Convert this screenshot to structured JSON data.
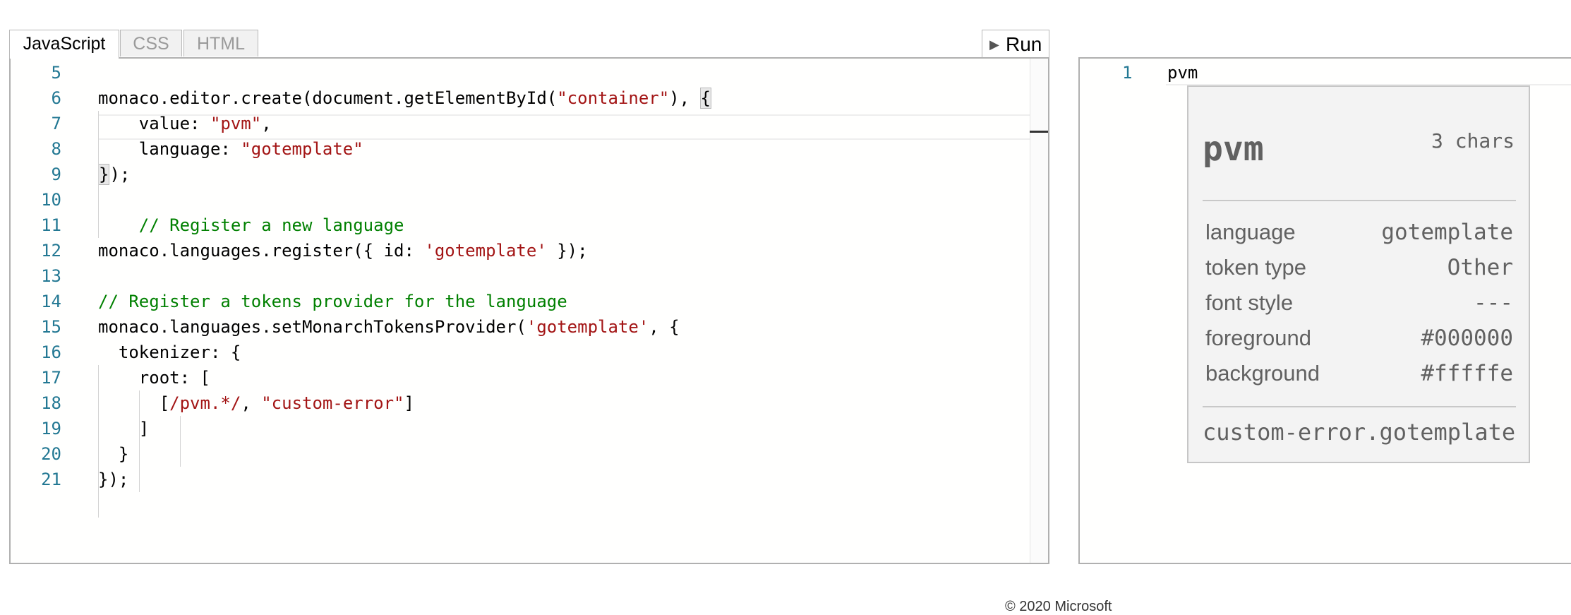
{
  "tabs": [
    "JavaScript",
    "CSS",
    "HTML"
  ],
  "run_label": "Run",
  "run_icon": "play-icon",
  "code_lines": [
    {
      "n": "5",
      "tokens": []
    },
    {
      "n": "6",
      "tokens": [
        [
          "",
          "monaco.editor.create(document.getElementById("
        ],
        [
          "str",
          "\"container\""
        ],
        [
          "",
          "), "
        ],
        [
          "brk",
          "{"
        ]
      ]
    },
    {
      "n": "7",
      "tokens": [
        [
          "",
          "    value: "
        ],
        [
          "str",
          "\"pvm\""
        ],
        [
          "",
          ","
        ]
      ]
    },
    {
      "n": "8",
      "tokens": [
        [
          "",
          "    language: "
        ],
        [
          "str",
          "\"gotemplate\""
        ]
      ]
    },
    {
      "n": "9",
      "tokens": [
        [
          "brk",
          "}"
        ],
        [
          "",
          ");"
        ]
      ]
    },
    {
      "n": "10",
      "tokens": []
    },
    {
      "n": "11",
      "tokens": [
        [
          "cmt",
          "    // Register a new language"
        ]
      ]
    },
    {
      "n": "12",
      "tokens": [
        [
          "",
          "monaco.languages.register({ id: "
        ],
        [
          "str",
          "'gotemplate'"
        ],
        [
          "",
          " });"
        ]
      ]
    },
    {
      "n": "13",
      "tokens": []
    },
    {
      "n": "14",
      "tokens": [
        [
          "cmt",
          "// Register a tokens provider for the language"
        ]
      ]
    },
    {
      "n": "15",
      "tokens": [
        [
          "",
          "monaco.languages.setMonarchTokensProvider("
        ],
        [
          "str",
          "'gotemplate'"
        ],
        [
          "",
          ", {"
        ]
      ]
    },
    {
      "n": "16",
      "tokens": [
        [
          "",
          "  tokenizer: {"
        ]
      ]
    },
    {
      "n": "17",
      "tokens": [
        [
          "",
          "    root: ["
        ]
      ]
    },
    {
      "n": "18",
      "tokens": [
        [
          "",
          "      ["
        ],
        [
          "str",
          "/pvm.*/"
        ],
        [
          "",
          ", "
        ],
        [
          "str",
          "\"custom-error\""
        ],
        [
          "",
          "]"
        ]
      ]
    },
    {
      "n": "19",
      "tokens": [
        [
          "",
          "    ]"
        ]
      ]
    },
    {
      "n": "20",
      "tokens": [
        [
          "",
          "  }"
        ]
      ]
    },
    {
      "n": "21",
      "tokens": [
        [
          "",
          "});"
        ]
      ]
    }
  ],
  "preview": {
    "line_number": "1",
    "line_text": "pvm",
    "inspect": {
      "token": "pvm",
      "length": "3 chars",
      "rows": [
        {
          "key": "language",
          "value": "gotemplate"
        },
        {
          "key": "token type",
          "value": "Other"
        },
        {
          "key": "font style",
          "value": "---"
        },
        {
          "key": "foreground",
          "value": "#000000"
        },
        {
          "key": "background",
          "value": "#fffffe"
        }
      ],
      "scope": "custom-error.gotemplate"
    }
  },
  "footer": "© 2020 Microsoft",
  "colors": {
    "line_number": "#237893",
    "string": "#a31515",
    "comment": "#008000",
    "editor_background": "#fffffe"
  }
}
